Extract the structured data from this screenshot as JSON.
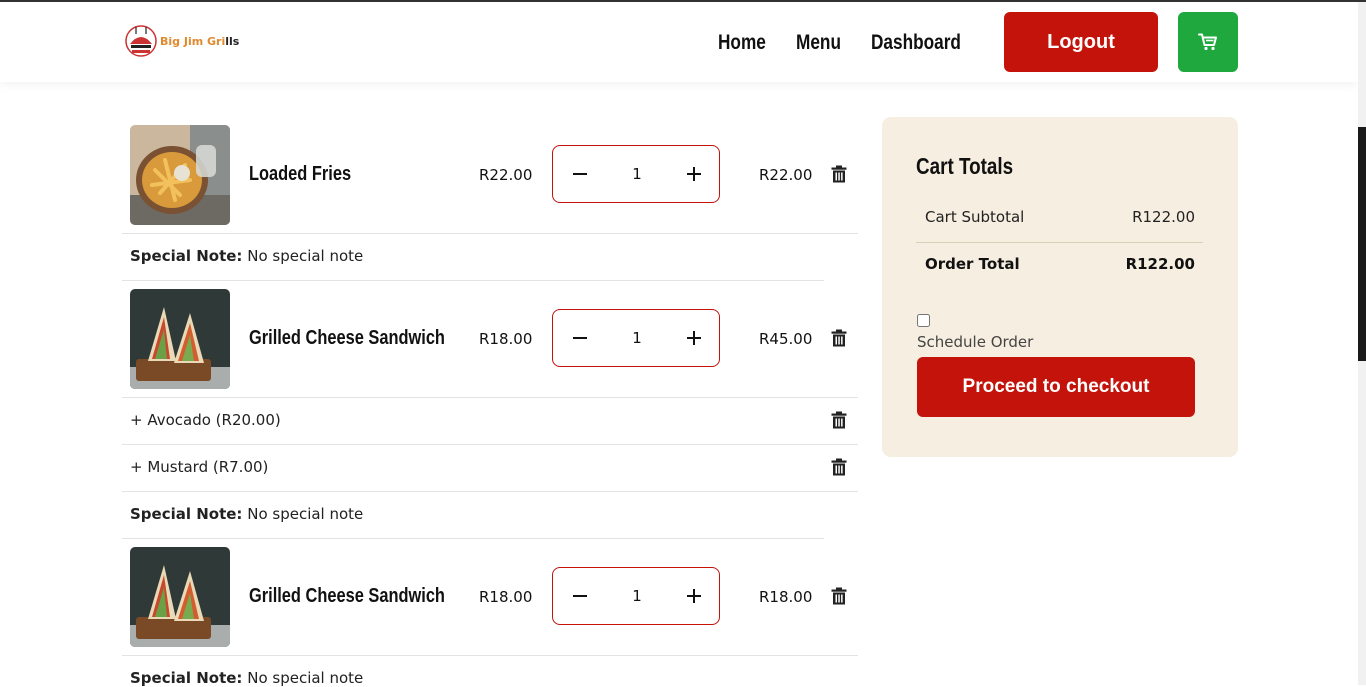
{
  "brand": {
    "name_part1": "Big Jim Gri",
    "name_part2": "lls",
    "colors": {
      "primary_red": "#c3130b",
      "cart_green": "#1ea83e",
      "panel_beige": "#f6eee0"
    }
  },
  "nav": {
    "links": [
      "Home",
      "Menu",
      "Dashboard"
    ],
    "logout_label": "Logout",
    "cart_icon": "shopping-cart-icon"
  },
  "cart": {
    "items": [
      {
        "name": "Loaded Fries",
        "price": "R22.00",
        "quantity": "1",
        "total": "R22.00",
        "note_label": "Special Note:",
        "note": "No special note",
        "addons": []
      },
      {
        "name": "Grilled Cheese Sandwich",
        "price": "R18.00",
        "quantity": "1",
        "total": "R45.00",
        "note_label": "Special Note:",
        "note": "No special note",
        "addons": [
          "+ Avocado (R20.00)",
          "+ Mustard (R7.00)"
        ]
      },
      {
        "name": "Grilled Cheese Sandwich",
        "price": "R18.00",
        "quantity": "1",
        "total": "R18.00",
        "note_label": "Special Note:",
        "note": "No special note",
        "addons": []
      }
    ]
  },
  "totals": {
    "title": "Cart Totals",
    "subtotal_label": "Cart Subtotal",
    "subtotal": "R122.00",
    "order_total_label": "Order Total",
    "order_total": "R122.00",
    "schedule_label": "Schedule Order",
    "checkout_label": "Proceed to checkout"
  }
}
